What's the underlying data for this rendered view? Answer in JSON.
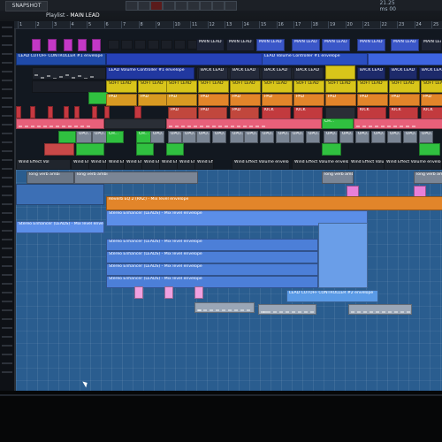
{
  "app": {
    "menu_label": "SNAPSHOT",
    "playlist_label": "Playlist",
    "playlist_pattern": "MAIN LEAD",
    "cpu_lines": [
      "21.25 ",
      "ms  00"
    ]
  },
  "timeline": {
    "bars": [
      "1",
      "2",
      "3",
      "4",
      "5",
      "6",
      "7",
      "8",
      "9",
      "10",
      "11",
      "12",
      "13",
      "14",
      "15",
      "16",
      "17",
      "18",
      "19",
      "20",
      "21",
      "22",
      "23",
      "24",
      "25"
    ]
  },
  "clips": {
    "main_lead": "MAIN LEAD",
    "back_lead": "BACK LEAD",
    "soft_lead": "SOFT LEAD",
    "pad": "PAD",
    "kick": "KICK",
    "upo": "UPO...",
    "ch": "CH...",
    "lead_cutoff_controller": "LEAD CUTOFF CONTROLLER #1 envelope",
    "lead_volume": "LEAD Volume Controller #1 envelope",
    "wind_effect": "Wind Effect Vol",
    "wind_effect_long": "Wind Effect Volume envelope",
    "long_verb": "long verb ambi",
    "reverb_eq": "Reverb EQ 2 (RAZ) - Mix level envelope",
    "stereo_enhancer": "Stereo Enhancer (LEADS) - Mix level envelope",
    "lead_cutoff_2": "LEAD CUTOFF CONTROLLER #2 envelope"
  },
  "colors": {
    "bg": "#121820",
    "main_lead": "#c338c6",
    "blue": "#2a4ec0",
    "yellow": "#d8c51a",
    "orange": "#e2852a",
    "red": "#c53840",
    "pink": "#e8607a",
    "green": "#30c040",
    "grey": "#7a8594",
    "teal": "#1f3b5a",
    "lightblue": "#4a7fd6",
    "envelope": "#3c6fb5"
  }
}
